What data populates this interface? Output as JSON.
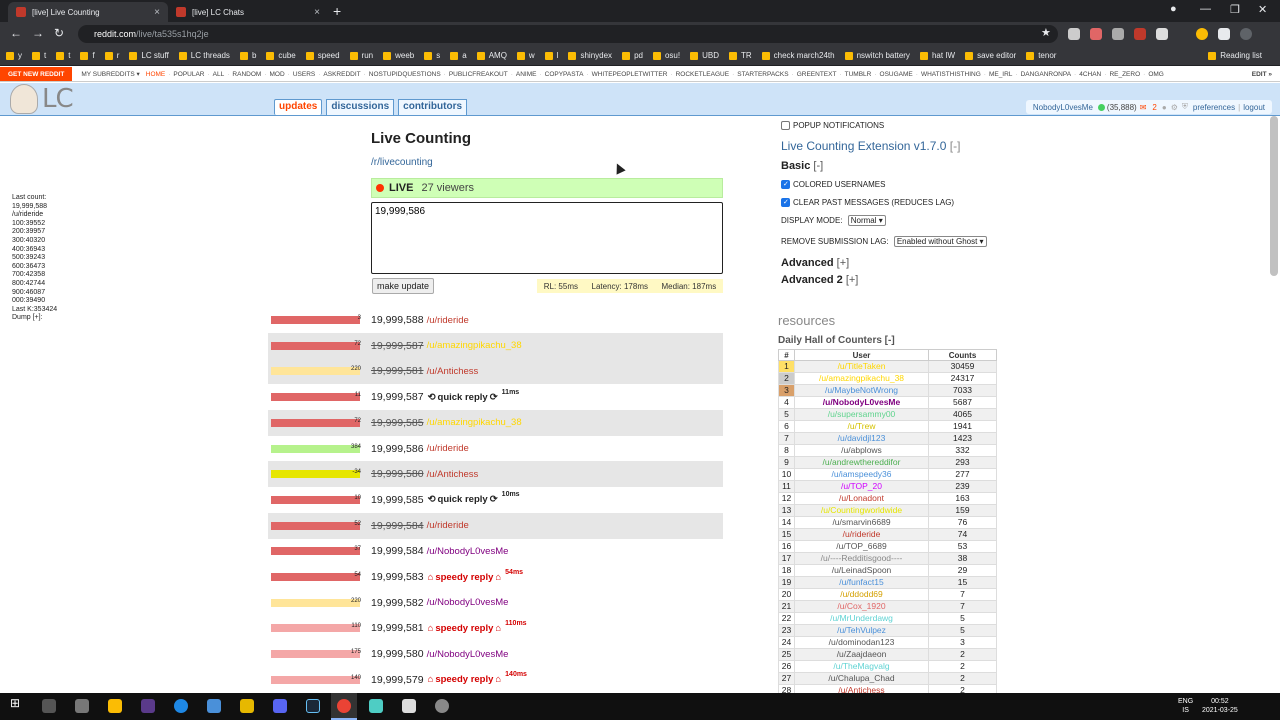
{
  "browser": {
    "tabs": [
      {
        "label": "[live] Live Counting",
        "close": "×",
        "active": true
      },
      {
        "label": "[live] LC Chats",
        "close": "×",
        "active": false
      }
    ],
    "new_tab": "+",
    "url_host": "reddit.com",
    "url_path": "/live/ta535s1hq2je",
    "bookmarks": [
      "y",
      "t",
      "t",
      "f",
      "r",
      "LC stuff",
      "LC threads",
      "b",
      "cube",
      "speed",
      "run",
      "weeb",
      "s",
      "a",
      "AMQ",
      "w",
      "l",
      "shinydex",
      "pd",
      "osu!",
      "UBD",
      "TR",
      "check march24th",
      "nswitch battery",
      "hat IW",
      "save editor",
      "tenor"
    ],
    "reading_list": "Reading list"
  },
  "reddit": {
    "get_new": "GET NEW REDDIT",
    "my_subreddits": "MY SUBREDDITS ▾",
    "subreddits": [
      "HOME",
      "POPULAR",
      "ALL",
      "RANDOM",
      "MOD",
      "USERS",
      "ASKREDDIT",
      "NOSTUPIDQUESTIONS",
      "PUBLICFREAKOUT",
      "ANIME",
      "COPYPASTA",
      "WHITEPEOPLETWITTER",
      "ROCKETLEAGUE",
      "STARTERPACKS",
      "GREENTEXT",
      "TUMBLR",
      "OSUGAME",
      "WHATISTHISTHING",
      "ME_IRL",
      "DANGANRONPA",
      "4CHAN",
      "RE_ZERO",
      "OMG"
    ],
    "edit": "EDIT »",
    "logo_text": "LC",
    "tabs": [
      "updates",
      "discussions",
      "contributors"
    ],
    "user": "NobodyL0vesMe",
    "karma": "(35,888)",
    "mail_count": "2",
    "preferences": "preferences",
    "logout": "logout"
  },
  "stats": [
    "Last count:",
    "19,999,588",
    "/u/rideride",
    "100:39552",
    "200:39957",
    "300:40320",
    "400:36943",
    "500:39243",
    "600:36473",
    "700:42358",
    "800:42744",
    "900:46087",
    "000:39490",
    "Last K:353424",
    "Dump [+]:"
  ],
  "main": {
    "title": "Live Counting",
    "subreddit": "/r/livecounting",
    "live_label": "LIVE",
    "viewers": "27 viewers",
    "compose_value": "19,999,586",
    "make_update": "make update",
    "rl": "RL: 55ms",
    "latency": "Latency: 178ms",
    "median": "Median: 187ms"
  },
  "feed": [
    {
      "bar": "3",
      "count": "19,999,588",
      "user": "/u/rideride",
      "strike": false,
      "ucolor": "#c0392b",
      "bcolor": "#e06666",
      "fill": 0.97
    },
    {
      "bar": "72",
      "count": "19,999,587",
      "user": "/u/amazingpikachu_38",
      "strike": true,
      "ucolor": "#ffd700",
      "bcolor": "#e06666",
      "fill": 0.97
    },
    {
      "bar": "220",
      "count": "19,999,581",
      "user": "/u/Antichess",
      "strike": true,
      "ucolor": "#c0392b",
      "bcolor": "#ffe599",
      "fill": 0.97
    },
    {
      "bar": "11",
      "count": "19,999,587",
      "reply": "quick reply",
      "reply_ms": "11ms",
      "strike": false,
      "bcolor": "#e06666",
      "fill": 0.97
    },
    {
      "bar": "72",
      "count": "19,999,585",
      "user": "/u/amazingpikachu_38",
      "strike": true,
      "ucolor": "#ffd700",
      "bcolor": "#e06666",
      "fill": 0.97
    },
    {
      "bar": "384",
      "count": "19,999,586",
      "user": "/u/rideride",
      "strike": false,
      "ucolor": "#c0392b",
      "bcolor": "#b6f28c",
      "fill": 0.97
    },
    {
      "bar": "-34",
      "count": "19,999,580",
      "user": "/u/Antichess",
      "strike": true,
      "ucolor": "#c0392b",
      "bcolor": "#e6e600",
      "fill": 0.97
    },
    {
      "bar": "10",
      "count": "19,999,585",
      "reply": "quick reply",
      "reply_ms": "10ms",
      "strike": false,
      "bcolor": "#e06666",
      "fill": 0.97
    },
    {
      "bar": "52",
      "count": "19,999,584",
      "user": "/u/rideride",
      "strike": true,
      "ucolor": "#c0392b",
      "bcolor": "#e06666",
      "fill": 0.97
    },
    {
      "bar": "37",
      "count": "19,999,584",
      "user": "/u/NobodyL0vesMe",
      "strike": false,
      "ucolor": "#800080",
      "bcolor": "#e06666",
      "fill": 0.97
    },
    {
      "bar": "54",
      "count": "19,999,583",
      "reply": "speedy reply",
      "reply_ms": "54ms",
      "strike": false,
      "speedy": true,
      "bcolor": "#e06666",
      "fill": 0.97
    },
    {
      "bar": "220",
      "count": "19,999,582",
      "user": "/u/NobodyL0vesMe",
      "strike": false,
      "ucolor": "#800080",
      "bcolor": "#ffe599",
      "fill": 0.97
    },
    {
      "bar": "110",
      "count": "19,999,581",
      "reply": "speedy reply",
      "reply_ms": "110ms",
      "strike": false,
      "speedy": true,
      "bcolor": "#f4a7a7",
      "fill": 0.97
    },
    {
      "bar": "175",
      "count": "19,999,580",
      "user": "/u/NobodyL0vesMe",
      "strike": false,
      "ucolor": "#800080",
      "bcolor": "#f4a7a7",
      "fill": 0.97
    },
    {
      "bar": "140",
      "count": "19,999,579",
      "reply": "speedy reply",
      "reply_ms": "140ms",
      "strike": false,
      "speedy": true,
      "bcolor": "#f4a7a7",
      "fill": 0.97
    }
  ],
  "panel": {
    "popup": "POPUP NOTIFICATIONS",
    "ext_title": "Live Counting Extension v1.7.0",
    "ext_toggle": "[-]",
    "basic": "Basic",
    "basic_toggle": "[-]",
    "colored": "COLORED USERNAMES",
    "clear": "CLEAR PAST MESSAGES (REDUCES LAG)",
    "display_mode_label": "DISPLAY MODE:",
    "display_mode": "Normal",
    "remove_lag_label": "REMOVE SUBMISSION LAG:",
    "remove_lag": "Enabled without Ghost",
    "advanced": "Advanced",
    "advanced_toggle": "[+]",
    "advanced2": "Advanced 2",
    "advanced2_toggle": "[+]",
    "resources": "resources",
    "dhoc": "Daily Hall of Counters [-]",
    "headers": [
      "#",
      "User",
      "Counts"
    ],
    "rows": [
      [
        "1",
        "/u/TitleTaken",
        "30459",
        "#ffd700"
      ],
      [
        "2",
        "/u/amazingpikachu_38",
        "24317",
        "#ffd700"
      ],
      [
        "3",
        "/u/MaybeNotWrong",
        "7033",
        "#4a90d9"
      ],
      [
        "4",
        "/u/NobodyL0vesMe",
        "5687",
        "#800080"
      ],
      [
        "5",
        "/u/supersammy00",
        "4065",
        "#5fd38d"
      ],
      [
        "6",
        "/u/Trew",
        "1941",
        "#d4c200"
      ],
      [
        "7",
        "/u/davidjl123",
        "1423",
        "#4a90d9"
      ],
      [
        "8",
        "/u/abplows",
        "332",
        "#555"
      ],
      [
        "9",
        "/u/andrewthereddifor",
        "293",
        "#4caf50"
      ],
      [
        "10",
        "/u/iamspeedy36",
        "277",
        "#4a90d9"
      ],
      [
        "11",
        "/u/TOP_20",
        "239",
        "#d000ff"
      ],
      [
        "12",
        "/u/Lonadont",
        "163",
        "#c0392b"
      ],
      [
        "13",
        "/u/Countingworldwide",
        "159",
        "#e6e600"
      ],
      [
        "14",
        "/u/smarvin6689",
        "76",
        "#555"
      ],
      [
        "15",
        "/u/rideride",
        "74",
        "#c0392b"
      ],
      [
        "16",
        "/u/TOP_6689",
        "53",
        "#555"
      ],
      [
        "17",
        "/u/----Redditisgood----",
        "38",
        "#888"
      ],
      [
        "18",
        "/u/LeinadSpoon",
        "29",
        "#555"
      ],
      [
        "19",
        "/u/funfact15",
        "15",
        "#4a90d9"
      ],
      [
        "20",
        "/u/ddodd69",
        "7",
        "#d4a000"
      ],
      [
        "21",
        "/u/Cox_1920",
        "7",
        "#e06666"
      ],
      [
        "22",
        "/u/MrUnderdawg",
        "5",
        "#5fd3d3"
      ],
      [
        "23",
        "/u/TehVulpez",
        "5",
        "#4a90d9"
      ],
      [
        "24",
        "/u/dominodan123",
        "3",
        "#555"
      ],
      [
        "25",
        "/u/Zaajdaeon",
        "2",
        "#555"
      ],
      [
        "26",
        "/u/TheMagvalg",
        "2",
        "#5fd3d3"
      ],
      [
        "27",
        "/u/Chalupa_Chad",
        "2",
        "#555"
      ],
      [
        "28",
        "/u/Antichess",
        "2",
        "#c0392b"
      ]
    ]
  },
  "taskbar": {
    "lang1": "ENG",
    "lang2": "IS",
    "time": "00:52",
    "date": "2021-03-25"
  }
}
